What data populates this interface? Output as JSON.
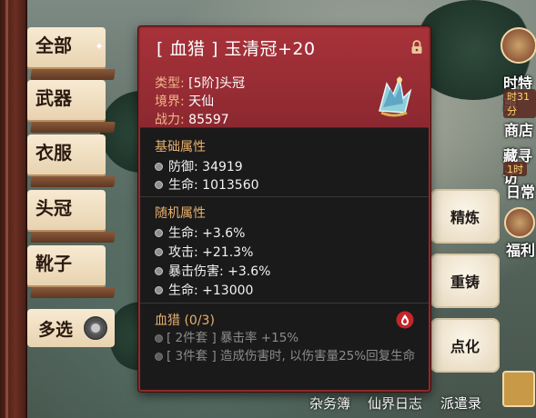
{
  "categories": [
    {
      "label": "全部"
    },
    {
      "label": "武器"
    },
    {
      "label": "衣服"
    },
    {
      "label": "头冠"
    },
    {
      "label": "靴子"
    }
  ],
  "multi_select": {
    "label": "多选",
    "checked": false
  },
  "item": {
    "name": "[ 血猎 ] 玉清冠+20",
    "locked": true,
    "type_key": "类型:",
    "type_value": "[5阶]头冠",
    "realm_key": "境界:",
    "realm_value": "天仙",
    "power_key": "战力:",
    "power_value": "85597",
    "icon": "crown-icon"
  },
  "base_attrs": {
    "title": "基础属性",
    "items": [
      {
        "text": "防御:  34919"
      },
      {
        "text": "生命:  1013560"
      }
    ]
  },
  "random_attrs": {
    "title": "随机属性",
    "items": [
      {
        "text": "生命:  +3.6%"
      },
      {
        "text": "攻击:  +21.3%"
      },
      {
        "text": "暴击伤害:  +3.6%"
      },
      {
        "text": "生命:  +13000"
      }
    ]
  },
  "set_bonus": {
    "title": "血猎  (0/3)",
    "lines": [
      {
        "text": "[ 2件套 ] 暴击率 +15%"
      },
      {
        "text": "[ 3件套 ] 造成伤害时, 以伤害量25%回复生命"
      }
    ]
  },
  "actions": [
    {
      "label": "精炼"
    },
    {
      "label": "重铸"
    },
    {
      "label": "点化"
    }
  ],
  "side": {
    "shop": "商店",
    "daily": "日常",
    "welfare": "福利",
    "special_offer": "时特惠",
    "offer_timer": "时31分",
    "treasure": "藏寻访",
    "treasure_timer": "1时"
  },
  "bottom_links": [
    "杂务簿",
    "仙界日志",
    "派遣录"
  ],
  "colors": {
    "panel_header": "#a8323a",
    "panel_bg": "#1b1a1a",
    "section_title": "#e6b070",
    "key_text": "#f0b58a",
    "disabled_text": "#8c8c8c"
  }
}
